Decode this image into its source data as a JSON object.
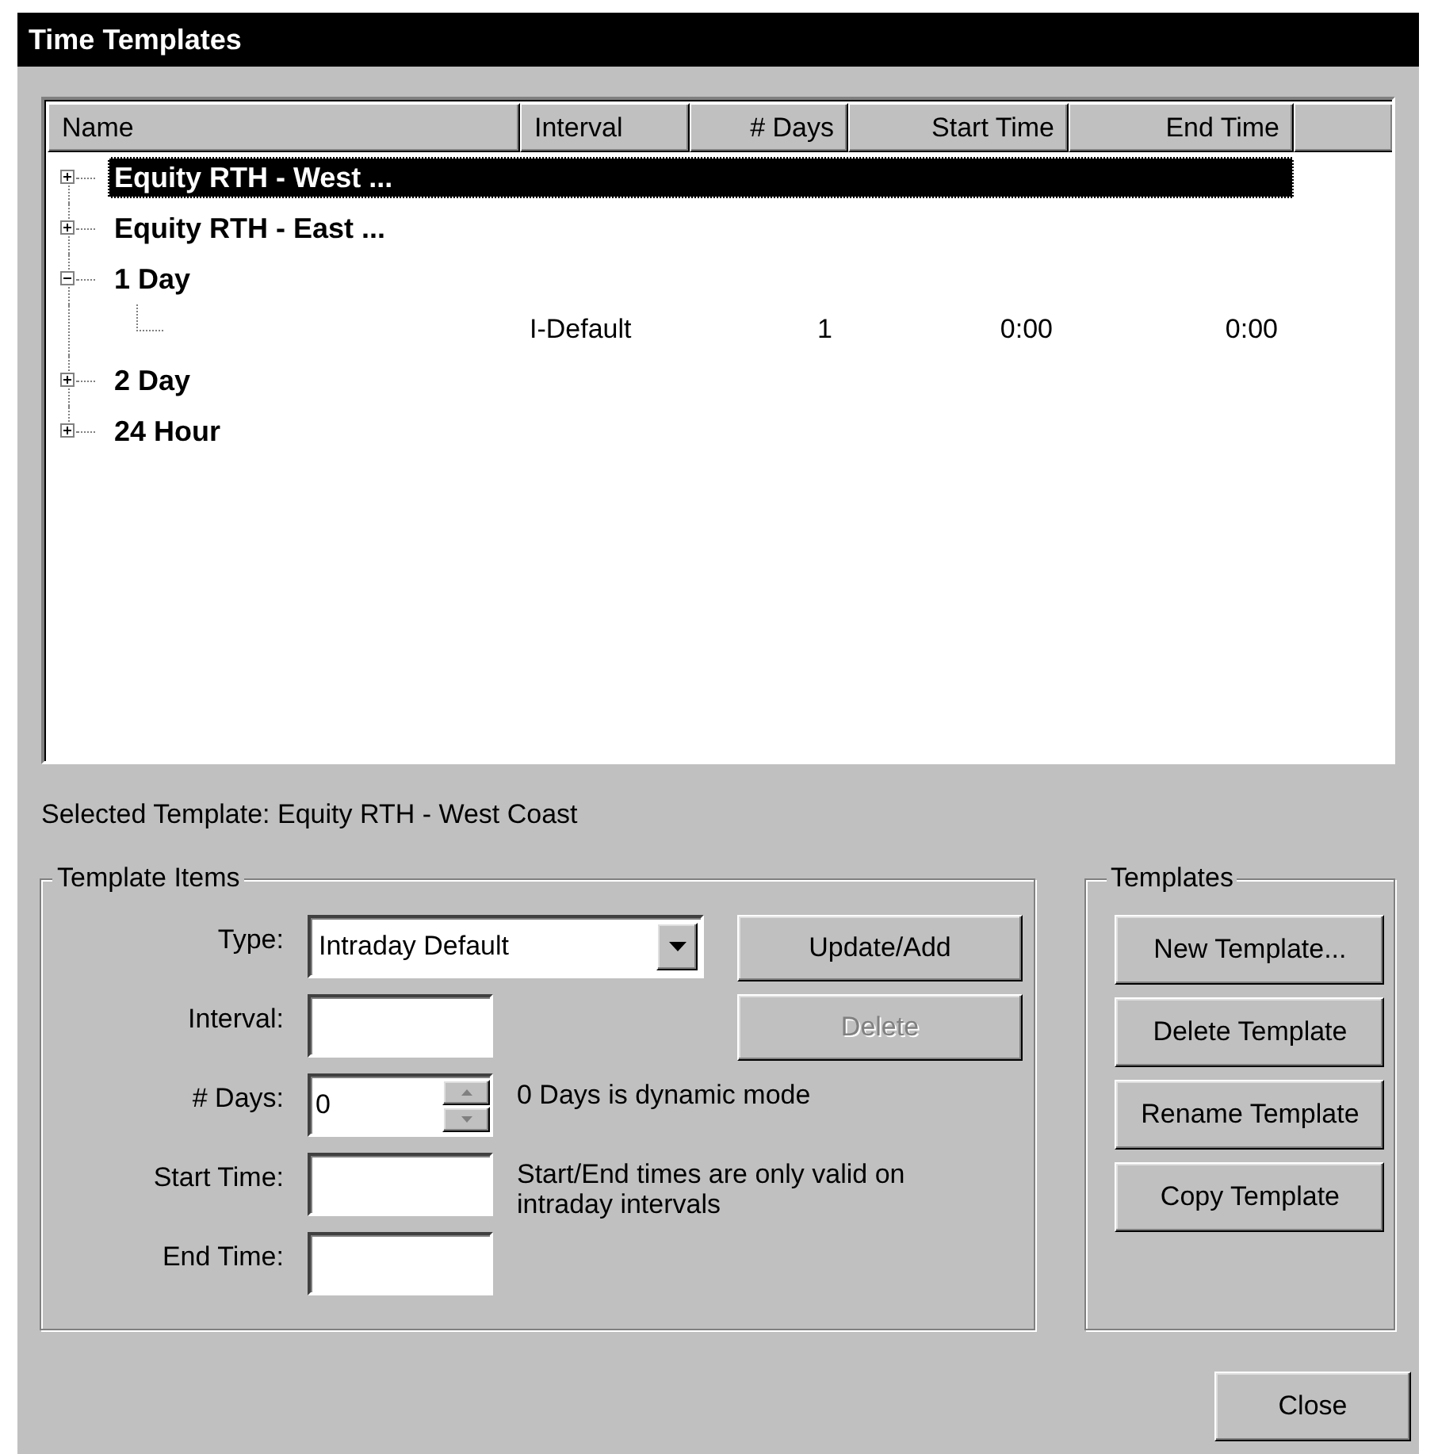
{
  "window": {
    "title": "Time Templates"
  },
  "tree": {
    "columns": [
      {
        "label": "Name"
      },
      {
        "label": "Interval"
      },
      {
        "label": "# Days"
      },
      {
        "label": "Start Time"
      },
      {
        "label": "End Time"
      }
    ],
    "items": [
      {
        "label": "Equity RTH - West ...",
        "expanded": false,
        "selected": true
      },
      {
        "label": "Equity RTH - East ...",
        "expanded": false,
        "selected": false
      },
      {
        "label": "1 Day",
        "expanded": true,
        "selected": false,
        "children": [
          {
            "interval": "I-Default",
            "days": "1",
            "start_time": "0:00",
            "end_time": "0:00"
          }
        ]
      },
      {
        "label": "2 Day",
        "expanded": false,
        "selected": false
      },
      {
        "label": "24 Hour",
        "expanded": false,
        "selected": false
      }
    ]
  },
  "selected_template": "Selected Template: Equity RTH - West Coast",
  "template_items": {
    "title": "Template Items",
    "fields": [
      {
        "kind": "dropdown",
        "label": "Type:",
        "value": "Intraday Default"
      },
      {
        "kind": "text",
        "label": "Interval:"
      },
      {
        "kind": "spin",
        "label": "# Days:",
        "value": "0",
        "note": "0 Days is dynamic mode"
      },
      {
        "kind": "text",
        "label": "Start Time:",
        "note": "Start/End times are only valid on intraday intervals"
      },
      {
        "kind": "text",
        "label": "End Time:"
      }
    ],
    "buttons": [
      {
        "label": "Update/Add",
        "disabled": false
      },
      {
        "label": "Delete",
        "disabled": true
      }
    ]
  },
  "templates": {
    "title": "Templates",
    "buttons": [
      {
        "label": "New Template...",
        "disabled": false
      },
      {
        "label": "Delete Template",
        "disabled": false
      },
      {
        "label": "Rename Template",
        "disabled": false
      },
      {
        "label": "Copy Template",
        "disabled": false
      }
    ]
  },
  "close_button": {
    "label": "Close",
    "disabled": false
  }
}
